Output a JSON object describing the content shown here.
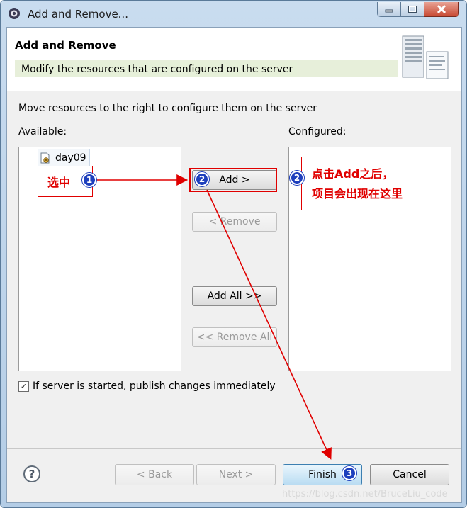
{
  "window": {
    "title": "Add and Remove...",
    "controls": [
      "minimize",
      "maximize",
      "close"
    ]
  },
  "banner": {
    "title": "Add and Remove",
    "description": "Modify the resources that are configured on the server"
  },
  "instruction": "Move resources to the right to configure them on the server",
  "available": {
    "label": "Available:",
    "items": [
      {
        "label": "day09",
        "icon": "project-icon"
      }
    ]
  },
  "configured": {
    "label": "Configured:",
    "items": []
  },
  "buttons": {
    "add": "Add >",
    "remove": "< Remove",
    "add_all": "Add All >>",
    "remove_all": "<< Remove All",
    "back": "< Back",
    "next": "Next >",
    "finish": "Finish",
    "cancel": "Cancel"
  },
  "publish_option": {
    "label": "If server is started, publish changes immediately",
    "checked": true
  },
  "help": "?",
  "annotations": {
    "select_text": "选中",
    "configured_text_line1": "点击Add之后，",
    "configured_text_line2": "项目会出现在这里",
    "badge_1": "1",
    "badge_2": "2",
    "badge_3": "3",
    "color": "#e00000",
    "badge_color": "#1e3fbd"
  },
  "watermark": "https://blog.csdn.net/BruceLiu_code"
}
